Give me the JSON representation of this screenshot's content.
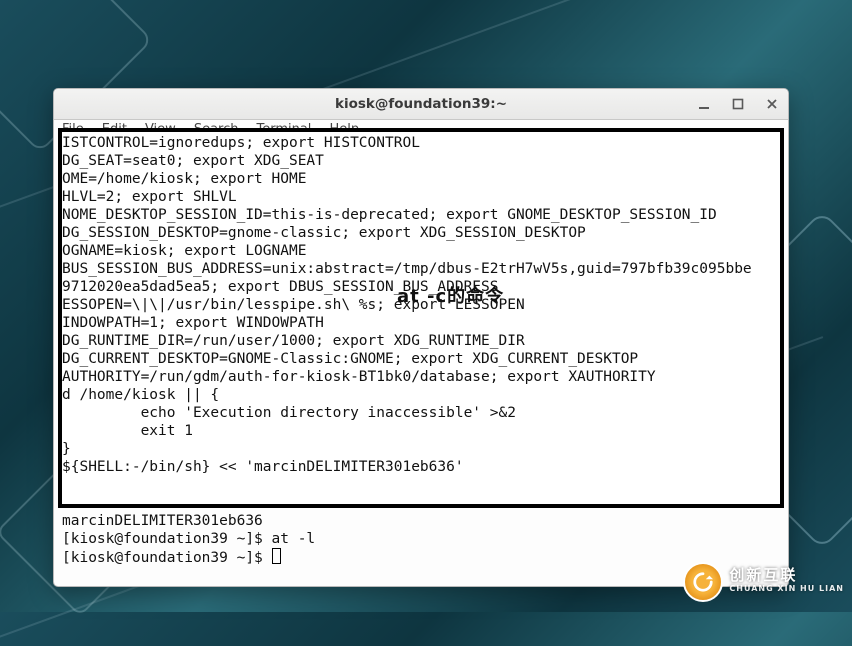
{
  "window": {
    "title": "kiosk@foundation39:~",
    "controls": {
      "minimize": "minimize-icon",
      "maximize": "maximize-icon",
      "close": "close-icon"
    }
  },
  "menubar": {
    "items": [
      "File",
      "Edit",
      "View",
      "Search",
      "Terminal",
      "Help"
    ]
  },
  "terminal": {
    "lines": [
      "ISTCONTROL=ignoredups; export HISTCONTROL",
      "DG_SEAT=seat0; export XDG_SEAT",
      "OME=/home/kiosk; export HOME",
      "HLVL=2; export SHLVL",
      "NOME_DESKTOP_SESSION_ID=this-is-deprecated; export GNOME_DESKTOP_SESSION_ID",
      "DG_SESSION_DESKTOP=gnome-classic; export XDG_SESSION_DESKTOP",
      "OGNAME=kiosk; export LOGNAME",
      "BUS_SESSION_BUS_ADDRESS=unix:abstract=/tmp/dbus-E2trH7wV5s,guid=797bfb39c095bbe",
      "9712020ea5dad5ea5; export DBUS_SESSION_BUS_ADDRESS",
      "ESSOPEN=\\|\\|/usr/bin/lesspipe.sh\\ %s; export LESSOPEN",
      "INDOWPATH=1; export WINDOWPATH",
      "DG_RUNTIME_DIR=/run/user/1000; export XDG_RUNTIME_DIR",
      "DG_CURRENT_DESKTOP=GNOME-Classic:GNOME; export XDG_CURRENT_DESKTOP",
      "AUTHORITY=/run/gdm/auth-for-kiosk-BT1bk0/database; export XAUTHORITY",
      "d /home/kiosk || {",
      "         echo 'Execution directory inaccessible' >&2",
      "         exit 1",
      "}",
      "${SHELL:-/bin/sh} << 'marcinDELIMITER301eb636'",
      "",
      "",
      "marcinDELIMITER301eb636",
      "[kiosk@foundation39 ~]$ at -l",
      "[kiosk@foundation39 ~]$ "
    ]
  },
  "overlay": {
    "label": "at -c的命令"
  },
  "watermark": {
    "cn": "创新互联",
    "en": "CHUANG XIN HU LIAN"
  }
}
